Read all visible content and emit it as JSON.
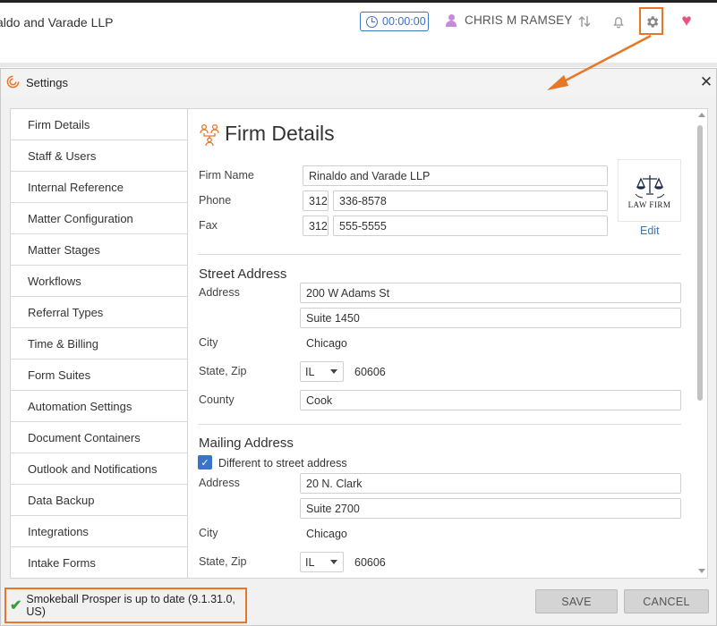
{
  "topbar": {
    "firm_name": "aldo and Varade LLP",
    "timer": "00:00:00",
    "user_name": "CHRIS M RAMSEY"
  },
  "dialog": {
    "title": "Settings",
    "close_glyph": "✕"
  },
  "sidebar": {
    "items": [
      {
        "label": "Firm Details"
      },
      {
        "label": "Staff & Users"
      },
      {
        "label": "Internal Reference"
      },
      {
        "label": "Matter Configuration"
      },
      {
        "label": "Matter Stages"
      },
      {
        "label": "Workflows"
      },
      {
        "label": "Referral Types"
      },
      {
        "label": "Time & Billing"
      },
      {
        "label": "Form Suites"
      },
      {
        "label": "Automation Settings"
      },
      {
        "label": "Document Containers"
      },
      {
        "label": "Outlook and Notifications"
      },
      {
        "label": "Data Backup"
      },
      {
        "label": "Integrations"
      },
      {
        "label": "Intake Forms"
      }
    ]
  },
  "firm_details": {
    "title": "Firm Details",
    "firm_name_label": "Firm Name",
    "firm_name": "Rinaldo and Varade LLP",
    "phone_label": "Phone",
    "phone_area": "312",
    "phone_number": "336-8578",
    "fax_label": "Fax",
    "fax_area": "312",
    "fax_number": "555-5555",
    "logo_text": "LAW FIRM",
    "edit_label": "Edit"
  },
  "street_address": {
    "title": "Street Address",
    "address_label": "Address",
    "line1": "200 W Adams St",
    "line2": "Suite 1450",
    "city_label": "City",
    "city": "Chicago",
    "state_zip_label": "State, Zip",
    "state": "IL",
    "zip": "60606",
    "county_label": "County",
    "county": "Cook"
  },
  "mailing_address": {
    "title": "Mailing Address",
    "different_label": "Different to street address",
    "different_checked": true,
    "address_label": "Address",
    "line1": "20 N. Clark",
    "line2": "Suite 2700",
    "city_label": "City",
    "city": "Chicago",
    "state_zip_label": "State, Zip",
    "state": "IL",
    "zip": "60606"
  },
  "footer": {
    "status": "Smokeball Prosper is up to date (9.1.31.0, US)",
    "save_label": "SAVE",
    "cancel_label": "CANCEL"
  },
  "colors": {
    "highlight": "#e77728",
    "accent_blue": "#3b73c5",
    "heart": "#e8557a",
    "success": "#3a9c3a"
  }
}
